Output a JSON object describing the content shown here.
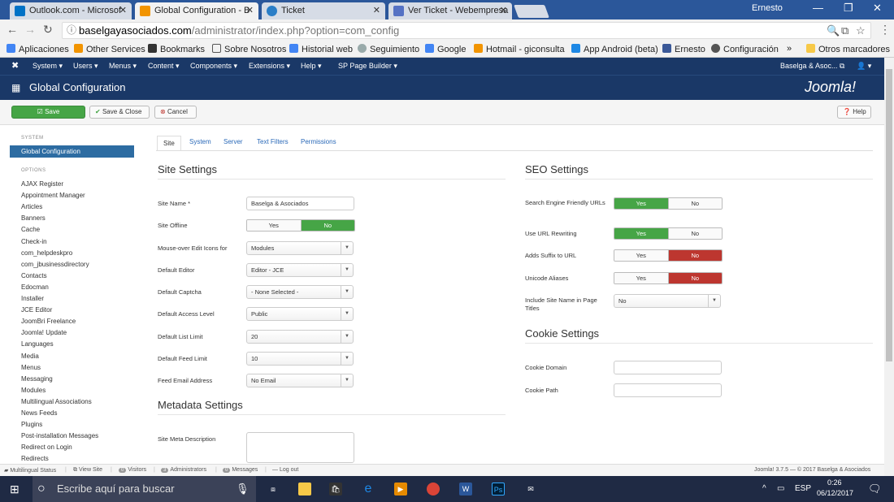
{
  "browser": {
    "tabs": [
      {
        "title": "Outlook.com - Microsof",
        "color": "#0072c6"
      },
      {
        "title": "Global Configuration - B",
        "color": "#f29400"
      },
      {
        "title": "Ticket",
        "color": "#2a7ec7"
      },
      {
        "title": "Ver Ticket - Webempresa",
        "color": "#5572c4"
      }
    ],
    "user": "Ernesto",
    "url_host": "baselgayasociados.com",
    "url_path": "/administrator/index.php?option=com_config",
    "bookmarks": [
      "Aplicaciones",
      "Other Services",
      "Bookmarks",
      "Sobre Nosotros",
      "Historial web",
      "Seguimiento",
      "Google",
      "Hotmail - giconsulta",
      "App Android (beta)",
      "Ernesto",
      "Configuración",
      "»",
      "Otros marcadores"
    ]
  },
  "admin_menu": {
    "items": [
      "System ▾",
      "Users ▾",
      "Menus ▾",
      "Content ▾",
      "Components ▾",
      "Extensions ▾",
      "Help ▾",
      "SP Page Builder ▾"
    ],
    "site_link": "Baselga & Asoc... ⧉",
    "user_menu": "👤 ▾"
  },
  "page_title": "Global Configuration",
  "logo_text": "Joomla!",
  "toolbar": {
    "save": "Save",
    "save_close": "Save & Close",
    "cancel": "Cancel",
    "help": "Help"
  },
  "sidebar": {
    "system_heading": "SYSTEM",
    "active_item": "Global Configuration",
    "options_heading": "OPTIONS",
    "items": [
      "AJAX Register",
      "Appointment Manager",
      "Articles",
      "Banners",
      "Cache",
      "Check-in",
      "com_helpdeskpro",
      "com_jbusinessdirectory",
      "Contacts",
      "Edocman",
      "Installer",
      "JCE Editor",
      "JoomBri Freelance",
      "Joomla! Update",
      "Languages",
      "Media",
      "Menus",
      "Messaging",
      "Modules",
      "Multilingual Associations",
      "News Feeds",
      "Plugins",
      "Post-installation Messages",
      "Redirect on Login",
      "Redirects"
    ]
  },
  "tabs": [
    "Site",
    "System",
    "Server",
    "Text Filters",
    "Permissions"
  ],
  "site_settings": {
    "title": "Site Settings",
    "site_name_label": "Site Name *",
    "site_name": "Baselga & Asociados",
    "offline_label": "Site Offline",
    "yes": "Yes",
    "no": "No",
    "mouseover_label": "Mouse-over Edit Icons for",
    "mouseover_value": "Modules",
    "editor_label": "Default Editor",
    "editor_value": "Editor - JCE",
    "captcha_label": "Default Captcha",
    "captcha_value": "- None Selected -",
    "access_label": "Default Access Level",
    "access_value": "Public",
    "list_label": "Default List Limit",
    "list_value": "20",
    "feed_label": "Default Feed Limit",
    "feed_value": "10",
    "email_label": "Feed Email Address",
    "email_value": "No Email"
  },
  "metadata": {
    "title": "Metadata Settings",
    "desc_label": "Site Meta Description"
  },
  "seo": {
    "title": "SEO Settings",
    "sef_label": "Search Engine Friendly URLs",
    "rewrite_label": "Use URL Rewriting",
    "suffix_label": "Adds Suffix to URL",
    "unicode_label": "Unicode Aliases",
    "sitename_label": "Include Site Name in Page Titles",
    "sitename_value": "No"
  },
  "cookie": {
    "title": "Cookie Settings",
    "domain_label": "Cookie Domain",
    "path_label": "Cookie Path"
  },
  "statusbar": {
    "multilingual": "Multilingual Status",
    "view_site": "View Site",
    "visitors_count": "0",
    "visitors": "Visitors",
    "admins_count": "3",
    "admins": "Administrators",
    "messages_count": "0",
    "messages": "Messages",
    "logout": "Log out",
    "version": "Joomla! 3.7.5 — © 2017 Baselga & Asociados"
  },
  "taskbar": {
    "search": "Escribe aquí para buscar",
    "lang": "ESP",
    "time": "0:26",
    "date": "06/12/2017"
  },
  "colors": {
    "green": "#46a546",
    "red": "#bd362f",
    "navy": "#1a3867",
    "active": "#2d6ca2"
  }
}
